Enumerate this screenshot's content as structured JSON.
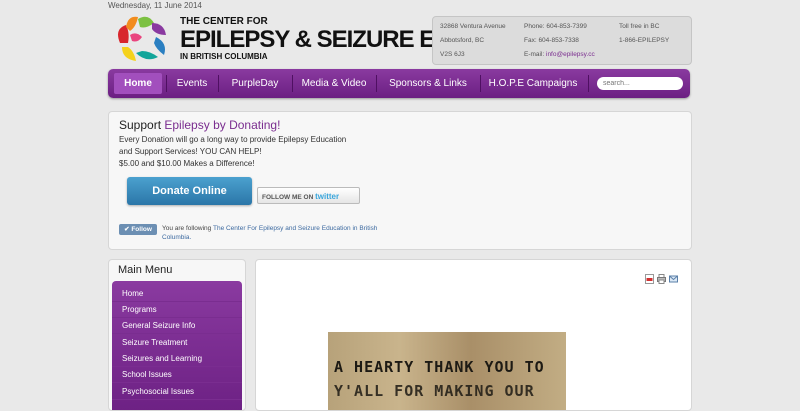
{
  "header": {
    "date": "Wednesday, 11 June 2014",
    "logo_line1": "THE CENTER FOR",
    "logo_line2": "EPILEPSY & SEIZURE EDUCATION",
    "logo_line3": "IN BRITISH COLUMBIA"
  },
  "contact": {
    "address1": "32868 Ventura Avenue",
    "address2": "Abbotsford, BC",
    "address3": "V2S 6J3",
    "phone": "Phone: 604-853-7399",
    "fax": "Fax: 604-853-7338",
    "email_label": "E-mail:",
    "email": "info@epilepsy.cc",
    "tollfree_label": "Toll free in BC",
    "tollfree": "1-866-EPILEPSY"
  },
  "nav": {
    "items": [
      "Home",
      "Events",
      "PurpleDay",
      "Media & Video",
      "Sponsors & Links",
      "H.O.P.E Campaigns"
    ],
    "search_placeholder": "search..."
  },
  "donate": {
    "title_plain": "Support ",
    "title_accent": "Epilepsy by Donating!",
    "line1": "Every Donation will go a long way to provide Epilepsy Education",
    "line2": "and Support Services! YOU CAN HELP!",
    "line3": "$5.00 and $10.00 Makes a Difference!",
    "button": "Donate Online",
    "twitter_prefix": "FOLLOW ME ON",
    "twitter_word": "twitter",
    "follow_button": "Follow",
    "follow_text": "You are following",
    "follow_link": "The Center For Epilepsy and Seizure Education in British Columbia."
  },
  "menu": {
    "title": "Main Menu",
    "items": [
      "Home",
      "Programs",
      "General Seizure Info",
      "Seizure Treatment",
      "Seizures and Learning",
      "School Issues",
      "Psychosocial Issues"
    ]
  },
  "content": {
    "image_line1": "A HEARTY THANK YOU TO",
    "image_line2": "Y'ALL FOR MAKING OUR",
    "icons": [
      "pdf-icon",
      "print-icon",
      "email-icon"
    ]
  },
  "colors": {
    "purple": "#7a2d8f",
    "nav_bg": "#6b1f82",
    "donate_blue": "#2b76a8"
  }
}
